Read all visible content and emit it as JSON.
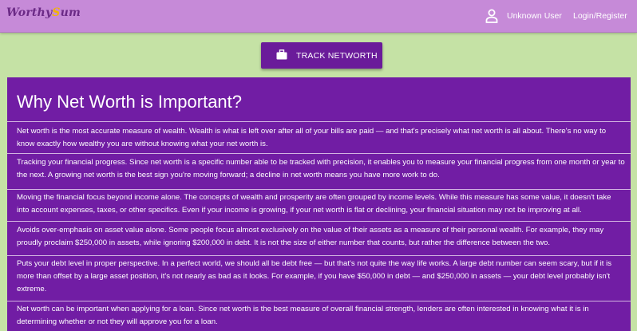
{
  "header": {
    "logo_left": "Worthy",
    "logo_mid": "S",
    "logo_right": "um",
    "user_label": "Unknown User",
    "login_label": "Login/Register"
  },
  "track_button": {
    "label": "TRACK NETWORTH"
  },
  "panel": {
    "title": "Why Net Worth is Important?",
    "paragraphs": [
      "Net worth is the most accurate measure of wealth. Wealth is what is left over after all of your bills are paid — and that's precisely what net worth is all about. There's no way to know exactly how wealthy you are without knowing what your net worth is.",
      "Tracking your financial progress. Since net worth is a specific number able to be tracked with precision, it enables you to measure your financial progress from one month or year to the next. A growing net worth is the best sign you're moving forward; a decline in net worth means you have more work to do.",
      "Moving the financial focus beyond income alone. The concepts of wealth and prosperity are often grouped by income levels. While this measure has some value, it doesn't take into account expenses, taxes, or other specifics. Even if your income is growing, if your net worth is flat or declining, your financial situation may not be improving at all.",
      "Avoids over-emphasis on asset value alone. Some people focus almost exclusively on the value of their assets as a measure of their personal wealth. For example, they may proudly proclaim $250,000 in assets, while ignoring $200,000 in debt. It is not the size of either number that counts, but rather the difference between the two.",
      "Puts your debt level in proper perspective. In a perfect world, we should all be debt free — but that's not quite the way life works. A large debt number can seem scary, but if it is more than offset by a large asset position, it's not nearly as bad as it looks. For example, if you have $50,000 in debt — and $250,000 in assets — your debt level probably isn't extreme.",
      "Net worth can be important when applying for a loan. Since net worth is the best measure of overall financial strength, lenders are often interested in knowing what it is in determining whether or not they will approve you for a loan."
    ]
  },
  "colors": {
    "page_background": "#c5e2a5",
    "appbar": "#c68ad8",
    "button": "#6a1b9a",
    "panel": "#711da4",
    "logo_accent": "#f2b400"
  },
  "icons": {
    "user": "person-icon",
    "button": "briefcase-icon"
  }
}
